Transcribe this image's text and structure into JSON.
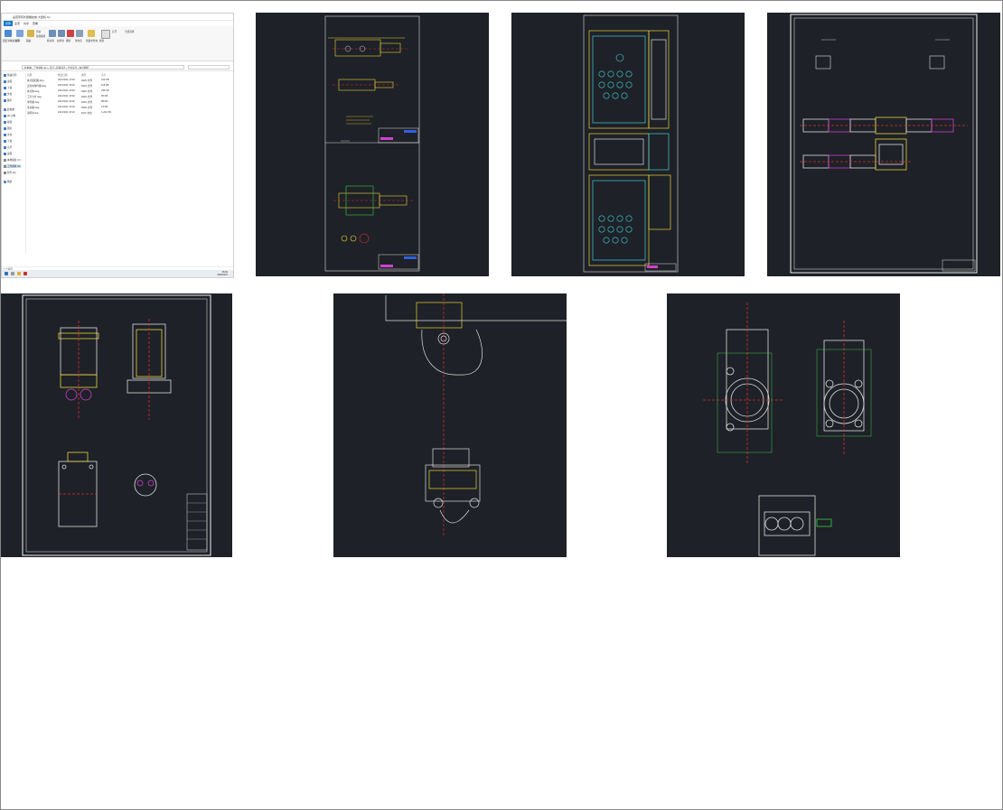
{
  "explorer": {
    "title": "是否带有外部螺纹类-大型机.zip",
    "tabs": [
      "文件",
      "主页",
      "共享",
      "查看"
    ],
    "address": "此电脑 › 工作资料 (D:) › 设计 › 机械设计 › 毕业设计 › 夹具图纸",
    "ribbon": [
      "固定到快速访问",
      "复制",
      "粘贴",
      "剪切",
      "复制路径",
      "移动到",
      "复制到",
      "删除",
      "重命名",
      "新建文件夹",
      "属性",
      "打开",
      "全部选择"
    ],
    "columns": [
      "名称",
      "修改日期",
      "类型",
      "大小"
    ],
    "files": [
      {
        "name": "夹具装配图.dwg",
        "date": "2021/3/21 15:02",
        "type": "DWG 文件",
        "size": "412 KB"
      },
      {
        "name": "定位块零件图.dwg",
        "date": "2021/3/21 15:02",
        "type": "DWG 文件",
        "size": "118 KB"
      },
      {
        "name": "夹具体.dwg",
        "date": "2021/3/21 15:02",
        "type": "DWG 文件",
        "size": "236 KB"
      },
      {
        "name": "工序卡片.dwg",
        "date": "2021/3/21 15:02",
        "type": "DWG 文件",
        "size": "95 KB"
      },
      {
        "name": "零件图.dwg",
        "date": "2021/3/21 15:02",
        "type": "DWG 文件",
        "size": "88 KB"
      },
      {
        "name": "毛坯图.dwg",
        "date": "2021/3/21 15:02",
        "type": "DWG 文件",
        "size": "76 KB"
      },
      {
        "name": "说明书.doc",
        "date": "2021/3/21 15:02",
        "type": "DOC 文档",
        "size": "1,204 KB"
      }
    ],
    "sidebar": [
      "快速访问",
      "桌面",
      "下载",
      "文档",
      "图片",
      "此电脑",
      "3D 对象",
      "视频",
      "图片",
      "文档",
      "下载",
      "音乐",
      "桌面",
      "本地磁盘 (C:)",
      "工作资料 (D:)",
      "软件 (E:)",
      "网络"
    ],
    "status": "7 个项目",
    "time": "15:02",
    "date": "2021/3/21"
  },
  "colors": {
    "cad_bg": "#1e2127",
    "yellow": "#e8d23a",
    "cyan": "#3fd0d8",
    "white": "#e8e8e8",
    "red": "#d83030",
    "magenta": "#d040d0",
    "green": "#3cc84a",
    "blue": "#3060e0"
  },
  "tiles": [
    {
      "name": "cad-drawing-shaft"
    },
    {
      "name": "cad-drawing-fixture-plate"
    },
    {
      "name": "cad-drawing-cylinders"
    },
    {
      "name": "cad-drawing-assembly"
    },
    {
      "name": "cad-drawing-bracket"
    },
    {
      "name": "cad-drawing-flange-block"
    }
  ]
}
